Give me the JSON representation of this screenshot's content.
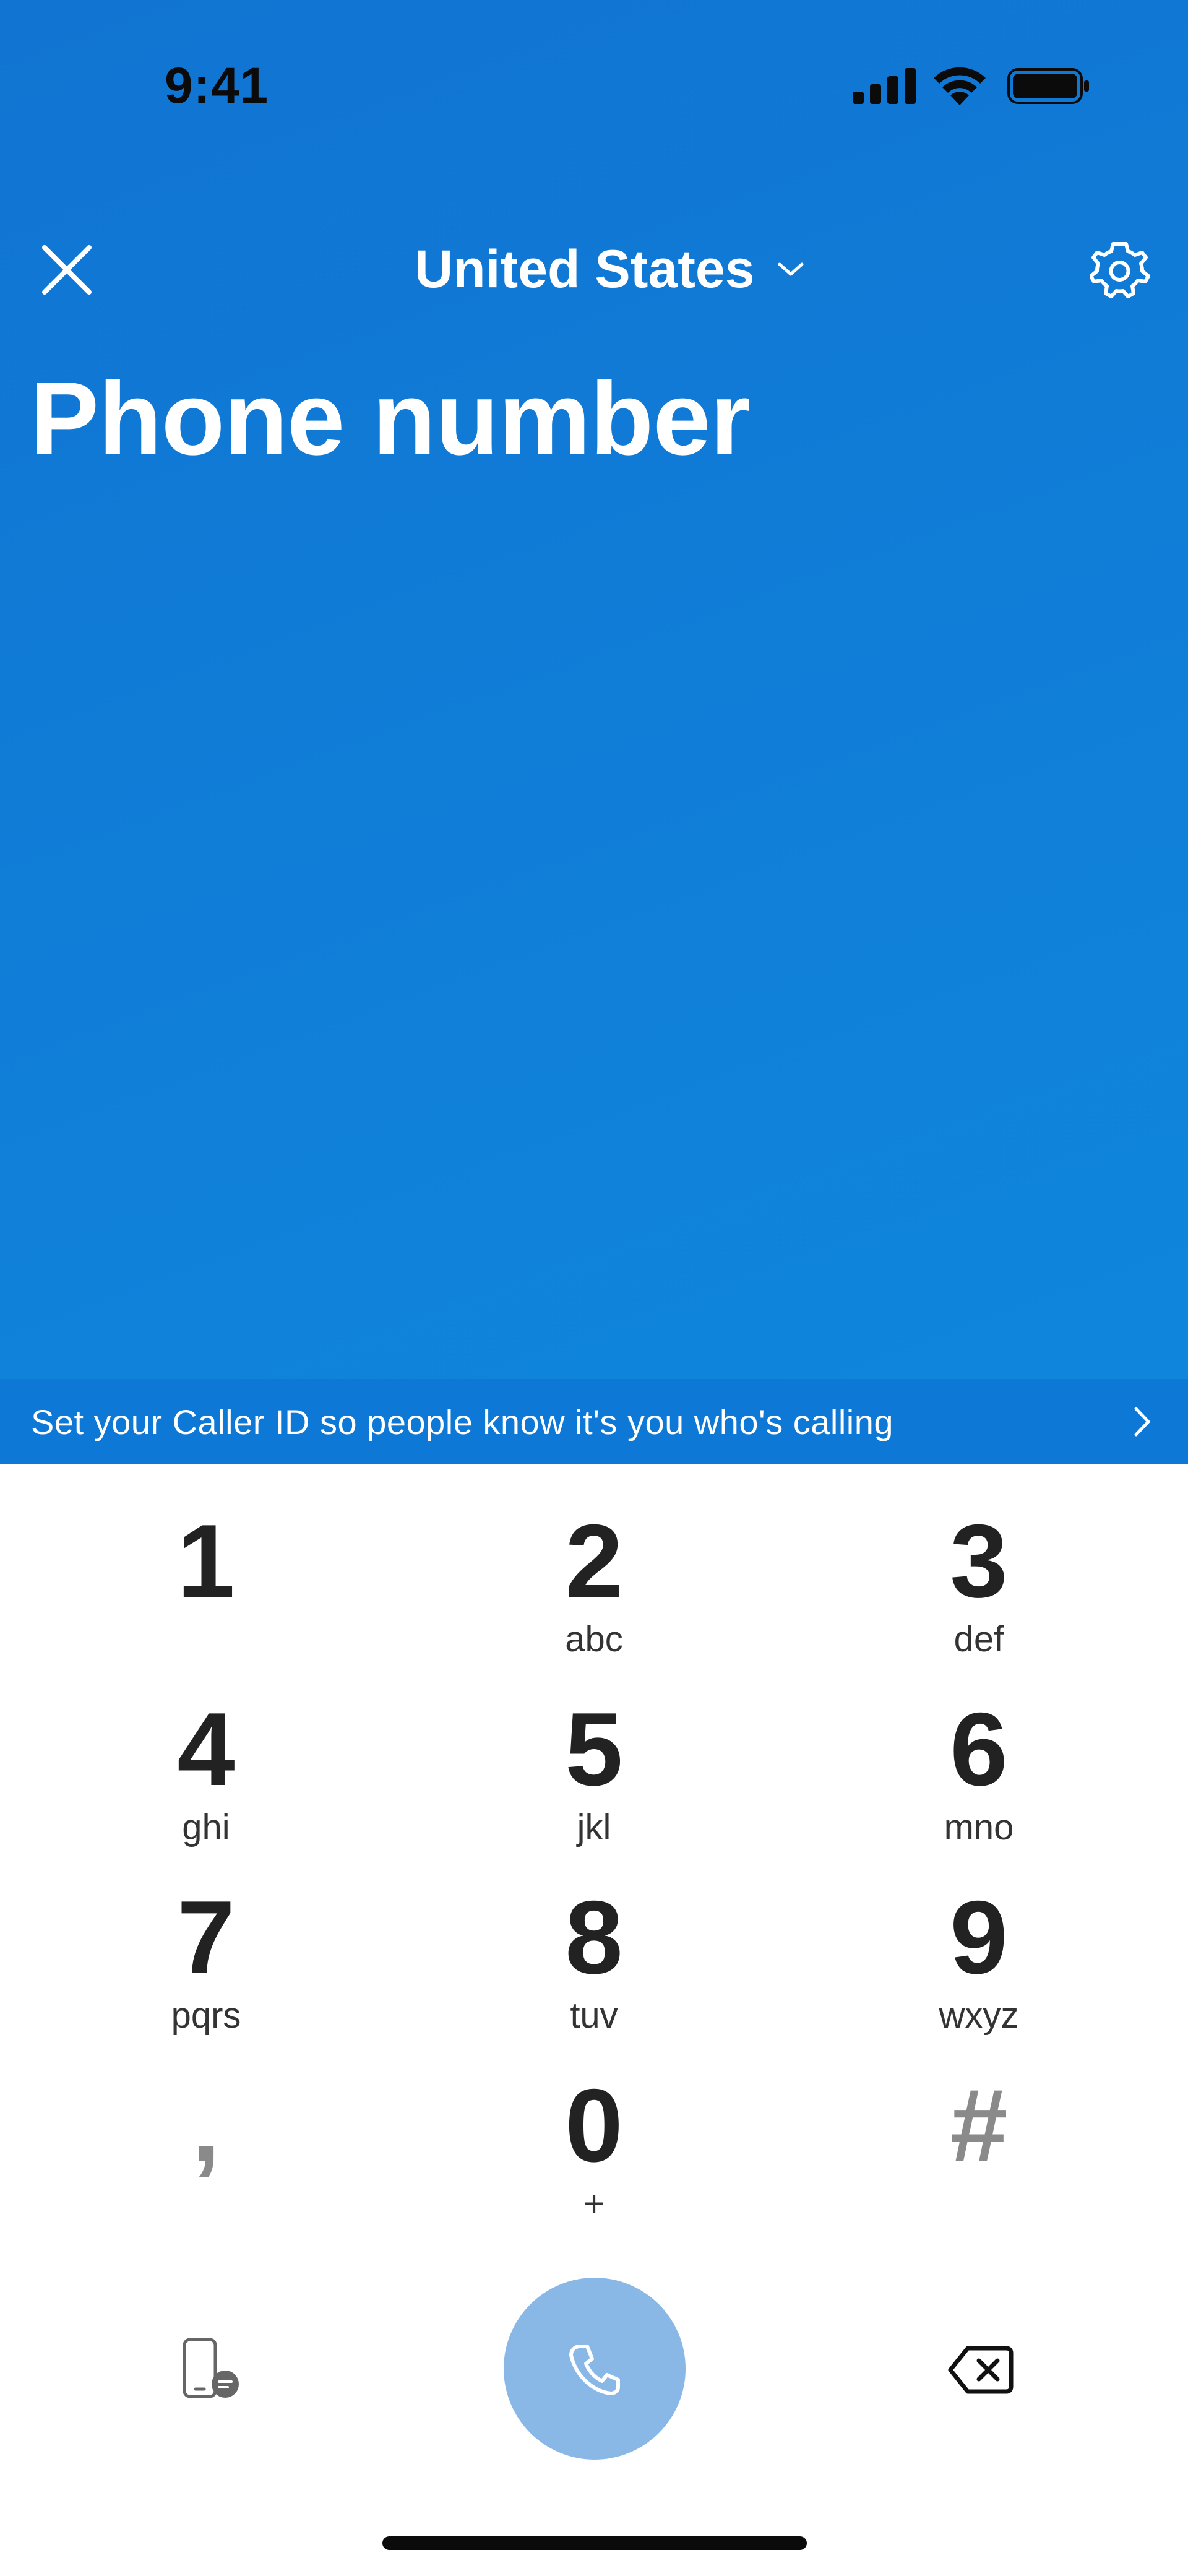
{
  "status_bar": {
    "time": "9:41"
  },
  "header": {
    "country": "United States",
    "title": "Phone number"
  },
  "caller_id_banner": {
    "text": "Set your Caller ID so people know it's you who's calling"
  },
  "keypad": {
    "keys": [
      {
        "digit": "1",
        "letters": ""
      },
      {
        "digit": "2",
        "letters": "abc"
      },
      {
        "digit": "3",
        "letters": "def"
      },
      {
        "digit": "4",
        "letters": "ghi"
      },
      {
        "digit": "5",
        "letters": "jkl"
      },
      {
        "digit": "6",
        "letters": "mno"
      },
      {
        "digit": "7",
        "letters": "pqrs"
      },
      {
        "digit": "8",
        "letters": "tuv"
      },
      {
        "digit": "9",
        "letters": "wxyz"
      },
      {
        "digit": ",",
        "letters": ""
      },
      {
        "digit": "0",
        "letters": "+"
      },
      {
        "digit": "#",
        "letters": ""
      }
    ]
  },
  "icons": {
    "close": "close-icon",
    "dropdown": "chevron-down-icon",
    "settings": "gear-icon",
    "banner_arrow": "chevron-right-icon",
    "sms": "phone-message-icon",
    "call": "phone-icon",
    "delete": "backspace-icon"
  },
  "colors": {
    "header_bg": "#1174d2",
    "banner_bg": "#0e78d6",
    "call_button": "#89b8e7",
    "text_dark": "#222222"
  }
}
